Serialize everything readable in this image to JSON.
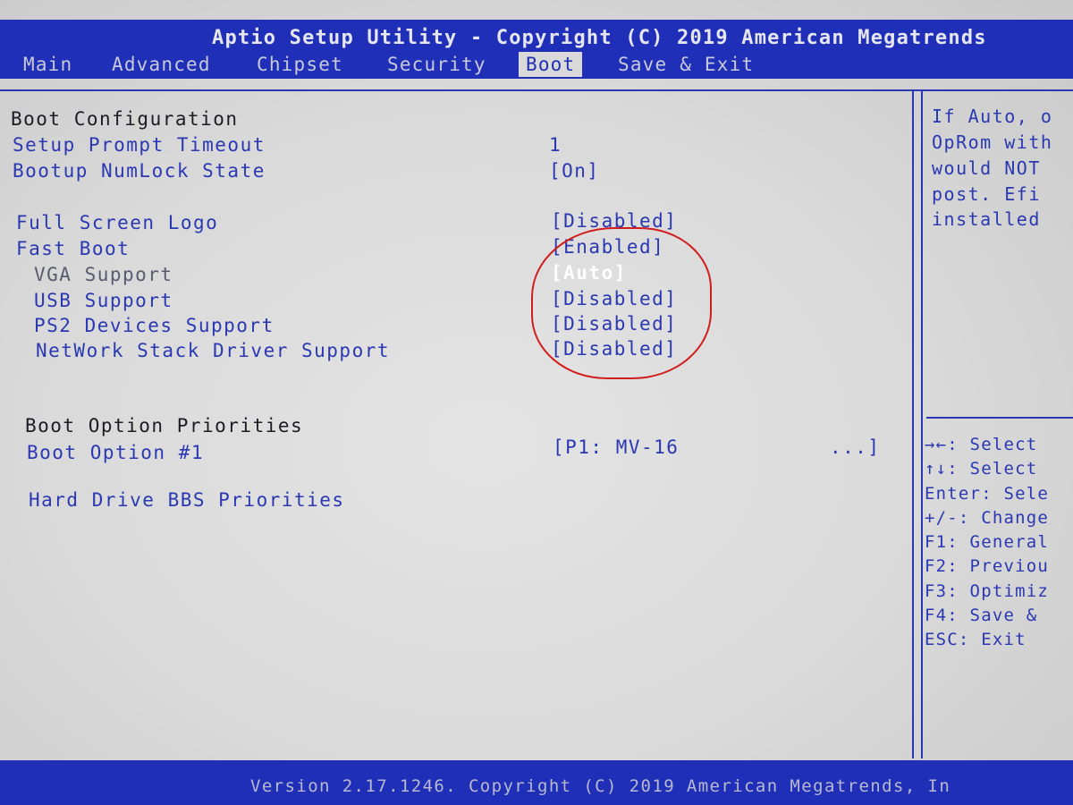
{
  "title": "Aptio Setup Utility - Copyright (C) 2019 American Megatrends",
  "tabs": [
    {
      "label": "Main",
      "active": false
    },
    {
      "label": "Advanced",
      "active": false
    },
    {
      "label": "Chipset",
      "active": false
    },
    {
      "label": "Security",
      "active": false
    },
    {
      "label": "Boot",
      "active": true
    },
    {
      "label": "Save & Exit",
      "active": false
    }
  ],
  "main": {
    "boot_config_heading": "Boot Configuration",
    "setup_prompt_timeout": {
      "label": "Setup Prompt Timeout",
      "value": "1"
    },
    "numlock_state": {
      "label": "Bootup NumLock State",
      "value": "[On]"
    },
    "full_screen_logo": {
      "label": "Full Screen Logo",
      "value": "[Disabled]"
    },
    "fast_boot": {
      "label": "Fast Boot",
      "value": "[Enabled]"
    },
    "vga_support": {
      "label": "VGA Support",
      "value": "[Auto]"
    },
    "usb_support": {
      "label": "USB Support",
      "value": "[Disabled]"
    },
    "ps2_support": {
      "label": "PS2 Devices Support",
      "value": "[Disabled]"
    },
    "network_stack": {
      "label": "NetWork Stack Driver Support",
      "value": "[Disabled]"
    },
    "boot_priorities_heading": "Boot Option Priorities",
    "boot_option_1": {
      "label": "Boot Option #1",
      "value": "[P1: MV-16",
      "value_end": "...]"
    },
    "hdd_bbs": {
      "label": "Hard Drive BBS Priorities"
    }
  },
  "help": {
    "lines": [
      "If Auto, o",
      "OpRom with",
      "would NOT",
      "post. Efi",
      "installed"
    ]
  },
  "keys": [
    "→←: Select",
    "↑↓: Select",
    "Enter: Sele",
    "+/-: Change",
    "F1: General",
    "F2: Previou",
    "F3: Optimiz",
    "F4: Save &",
    "ESC: Exit"
  ],
  "footer": "Version 2.17.1246. Copyright (C) 2019 American Megatrends, In",
  "colors": {
    "bar_blue": "#1f2fb8",
    "text_blue": "#2a38b2",
    "screen_bg": "#d9d9d9",
    "annotation_red": "#d11d1d"
  }
}
